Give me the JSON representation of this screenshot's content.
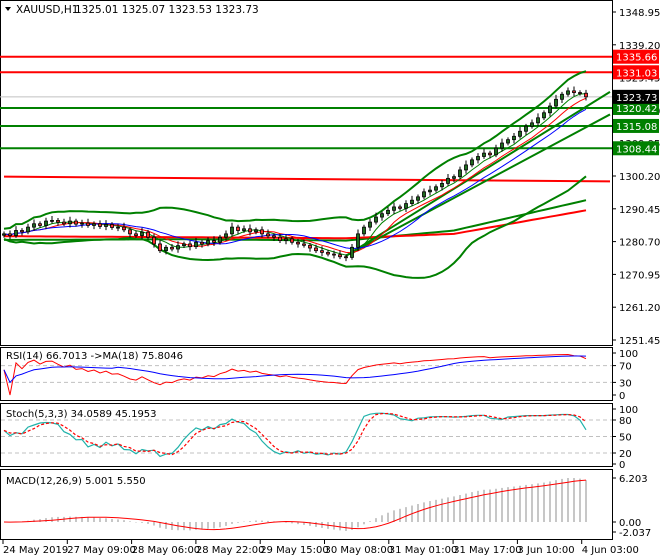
{
  "header": {
    "symbol": "XAUUSD,H1",
    "ohlc": "1325.01 1325.07 1323.53 1323.73"
  },
  "chart_data": {
    "type": "candlestick",
    "symbol": "XAUUSD,H1",
    "close": [
      1283,
      1282.5,
      1284,
      1283.6,
      1285,
      1286,
      1285.5,
      1286.8,
      1287,
      1286.5,
      1286,
      1286.8,
      1285.9,
      1286.2,
      1285.5,
      1286,
      1285.2,
      1285.8,
      1284.9,
      1285,
      1284.2,
      1283,
      1282.5,
      1283.5,
      1282,
      1280,
      1278,
      1279,
      1278.5,
      1279.5,
      1280,
      1279.2,
      1280.5,
      1280,
      1281,
      1280.5,
      1282,
      1283,
      1285,
      1284,
      1284.5,
      1283.6,
      1284.2,
      1283,
      1282.4,
      1282,
      1281,
      1281.5,
      1280.5,
      1280,
      1279.6,
      1278.8,
      1278,
      1277.5,
      1277,
      1276.8,
      1276.2,
      1276,
      1279,
      1283,
      1285,
      1286.5,
      1288,
      1289,
      1290,
      1291,
      1290.6,
      1292,
      1293,
      1294,
      1295.5,
      1296,
      1297,
      1298,
      1299.5,
      1300,
      1302,
      1303.5,
      1305,
      1306,
      1307,
      1306.5,
      1308.5,
      1310,
      1311,
      1312,
      1313.5,
      1315,
      1316,
      1317.5,
      1319,
      1321,
      1323,
      1324.5,
      1325.5,
      1325,
      1324.8,
      1323.73
    ],
    "price_axis": {
      "range": [
        1251.45,
        1348.95
      ],
      "ticks": [
        "1348.95",
        "1339.20",
        "1329.45",
        "1319.70",
        "1309.95",
        "1300.20",
        "1290.45",
        "1280.70",
        "1270.95",
        "1261.20",
        "1251.45"
      ]
    },
    "time_axis": {
      "labels": [
        "24 May 2019",
        "27 May 09:00",
        "28 May 06:00",
        "28 May 22:00",
        "29 May 15:00",
        "30 May 08:00",
        "31 May 01:00",
        "31 May 17:00",
        "3 Jun 10:00",
        "4 Jun 03:00"
      ]
    },
    "levels": [
      {
        "value": 1335.66,
        "label": "1335.66",
        "color": "#ff0000"
      },
      {
        "value": 1331.03,
        "label": "1331.03",
        "color": "#ff0000"
      },
      {
        "value": 1320.42,
        "label": "1320.42",
        "color": "#008000"
      },
      {
        "value": 1315.08,
        "label": "1315.08",
        "color": "#008000"
      },
      {
        "value": 1308.44,
        "label": "1308.44",
        "color": "#008000"
      }
    ],
    "current_price": {
      "value": 1323.73,
      "label": "1323.73",
      "color": "#000000"
    },
    "sloped_lines": [
      {
        "color": "#ff0000",
        "from": [
          0,
          1300.0
        ],
        "to": [
          101,
          1298.6
        ]
      },
      {
        "color": "#008000",
        "from": [
          57,
          1276.5
        ],
        "to": [
          101,
          1325.2
        ]
      },
      {
        "color": "#008000",
        "from": [
          57,
          1276.5
        ],
        "to": [
          101,
          1318.5
        ]
      }
    ],
    "slow_ma": [
      {
        "color": "#008000",
        "points": [
          [
            0,
            1281.2
          ],
          [
            30,
            1281.4
          ],
          [
            57,
            1281.0
          ],
          [
            75,
            1284
          ],
          [
            97,
            1293
          ]
        ]
      },
      {
        "color": "#ff0000",
        "points": [
          [
            0,
            1282.3
          ],
          [
            30,
            1282.0
          ],
          [
            57,
            1281.7
          ],
          [
            75,
            1283
          ],
          [
            97,
            1290
          ]
        ]
      }
    ],
    "bollinger": {
      "period": 20,
      "deviation": 2,
      "color": "#008000"
    },
    "moving_averages": [
      {
        "period": 5,
        "color": "#008000"
      },
      {
        "period": 8,
        "color": "#ff0000"
      },
      {
        "period": 13,
        "color": "#0000ff"
      }
    ],
    "rsi": {
      "label": "RSI(14) 66.7013  ->MA(18) 75.8046",
      "period": 14,
      "ma_period": 18,
      "levels": [
        70,
        30
      ],
      "axis": [
        "100",
        "70",
        "30",
        "0"
      ],
      "range": [
        0,
        100
      ]
    },
    "stoch": {
      "label": "Stoch(5,3,3) 34.0589 45.1953",
      "k": 5,
      "d": 3,
      "slowing": 3,
      "levels": [
        80,
        50,
        20
      ],
      "axis": [
        "100",
        "80",
        "50",
        "20",
        "0"
      ],
      "range": [
        0,
        100
      ]
    },
    "macd": {
      "label": "MACD(12,26,9) 5.001 5.550",
      "fast": 12,
      "slow": 26,
      "signal": 9,
      "axis": [
        "6.203",
        "0.00",
        "-2.037"
      ],
      "range": [
        -2.037,
        6.203
      ]
    }
  }
}
